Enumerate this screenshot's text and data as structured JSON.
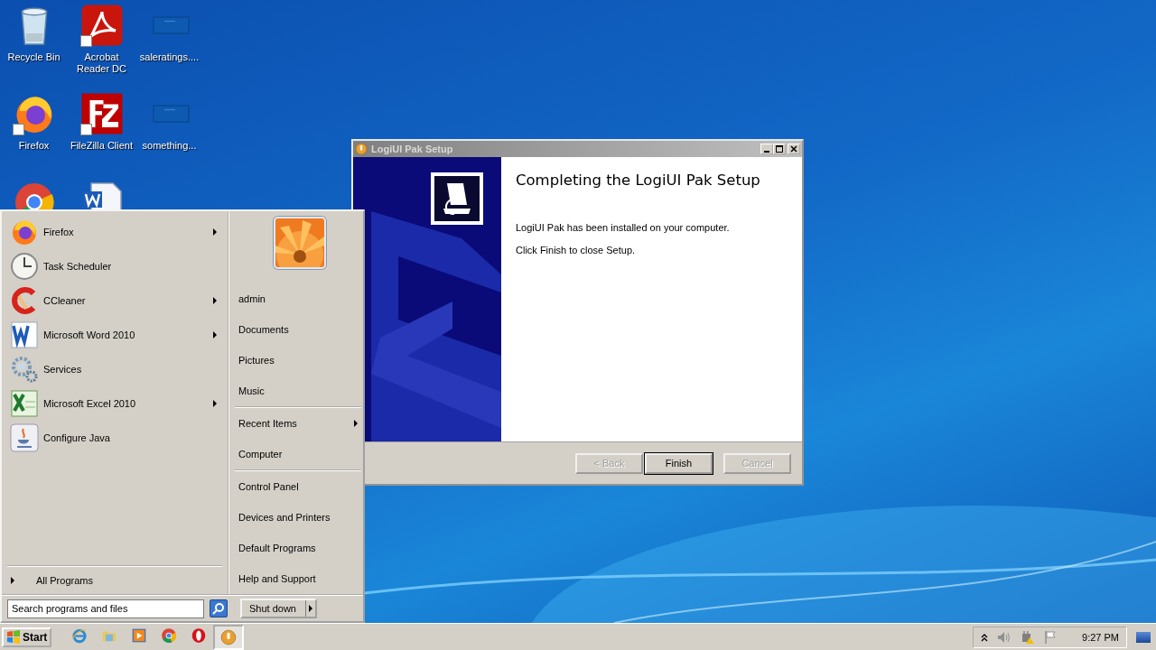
{
  "desktop_icons": [
    {
      "kind": "recycle",
      "label": "Recycle Bin"
    },
    {
      "kind": "acrobat",
      "label": "Acrobat Reader DC",
      "shortcut": true
    },
    {
      "kind": "blank",
      "label": "saleratings...."
    },
    {
      "kind": "firefox",
      "label": "Firefox",
      "shortcut": true
    },
    {
      "kind": "filezilla",
      "label": "FileZilla Client",
      "shortcut": true
    },
    {
      "kind": "blank",
      "label": "something..."
    },
    {
      "kind": "chrome"
    },
    {
      "kind": "worddoc"
    }
  ],
  "setup_window": {
    "title": "LogiUI Pak Setup",
    "heading": "Completing the LogiUI Pak Setup",
    "paragraphs": [
      "LogiUI Pak has been installed on your computer.",
      "Click Finish to close Setup."
    ],
    "buttons": [
      {
        "label": "< Back",
        "disabled": true,
        "default": false
      },
      {
        "label": "Finish",
        "disabled": false,
        "default": true
      },
      {
        "label": "Cancel",
        "disabled": true,
        "default": false
      }
    ]
  },
  "start_menu": {
    "programs": [
      {
        "kind": "firefox",
        "label": "Firefox",
        "has_submenu": true
      },
      {
        "kind": "clock",
        "label": "Task Scheduler",
        "has_submenu": false
      },
      {
        "kind": "ccleaner",
        "label": "CCleaner",
        "has_submenu": true
      },
      {
        "kind": "word",
        "label": "Microsoft Word 2010",
        "has_submenu": true
      },
      {
        "kind": "gears",
        "label": "Services",
        "has_submenu": false
      },
      {
        "kind": "excel",
        "label": "Microsoft Excel 2010",
        "has_submenu": true
      },
      {
        "kind": "java",
        "label": "Configure Java",
        "has_submenu": false
      }
    ],
    "all_programs": "All Programs",
    "place_groups": [
      [
        {
          "label": "admin",
          "has_submenu": false
        },
        {
          "label": "Documents",
          "has_submenu": false
        },
        {
          "label": "Pictures",
          "has_submenu": false
        },
        {
          "label": "Music",
          "has_submenu": false
        }
      ],
      [
        {
          "label": "Recent Items",
          "has_submenu": true
        },
        {
          "label": "Computer",
          "has_submenu": false
        }
      ],
      [
        {
          "label": "Control Panel",
          "has_submenu": false
        },
        {
          "label": "Devices and Printers",
          "has_submenu": false
        },
        {
          "label": "Default Programs",
          "has_submenu": false
        },
        {
          "label": "Help and Support",
          "has_submenu": false
        }
      ]
    ],
    "search": {
      "placeholder": "Search programs and files"
    },
    "shutdown": "Shut down"
  },
  "taskbar": {
    "start": "Start",
    "apps": [
      {
        "kind": "ie",
        "active": false
      },
      {
        "kind": "folder",
        "active": false
      },
      {
        "kind": "media",
        "active": false
      },
      {
        "kind": "chrome",
        "active": false
      },
      {
        "kind": "opera",
        "active": false
      },
      {
        "kind": "setup",
        "active": true
      }
    ],
    "clock": "9:27 PM"
  }
}
